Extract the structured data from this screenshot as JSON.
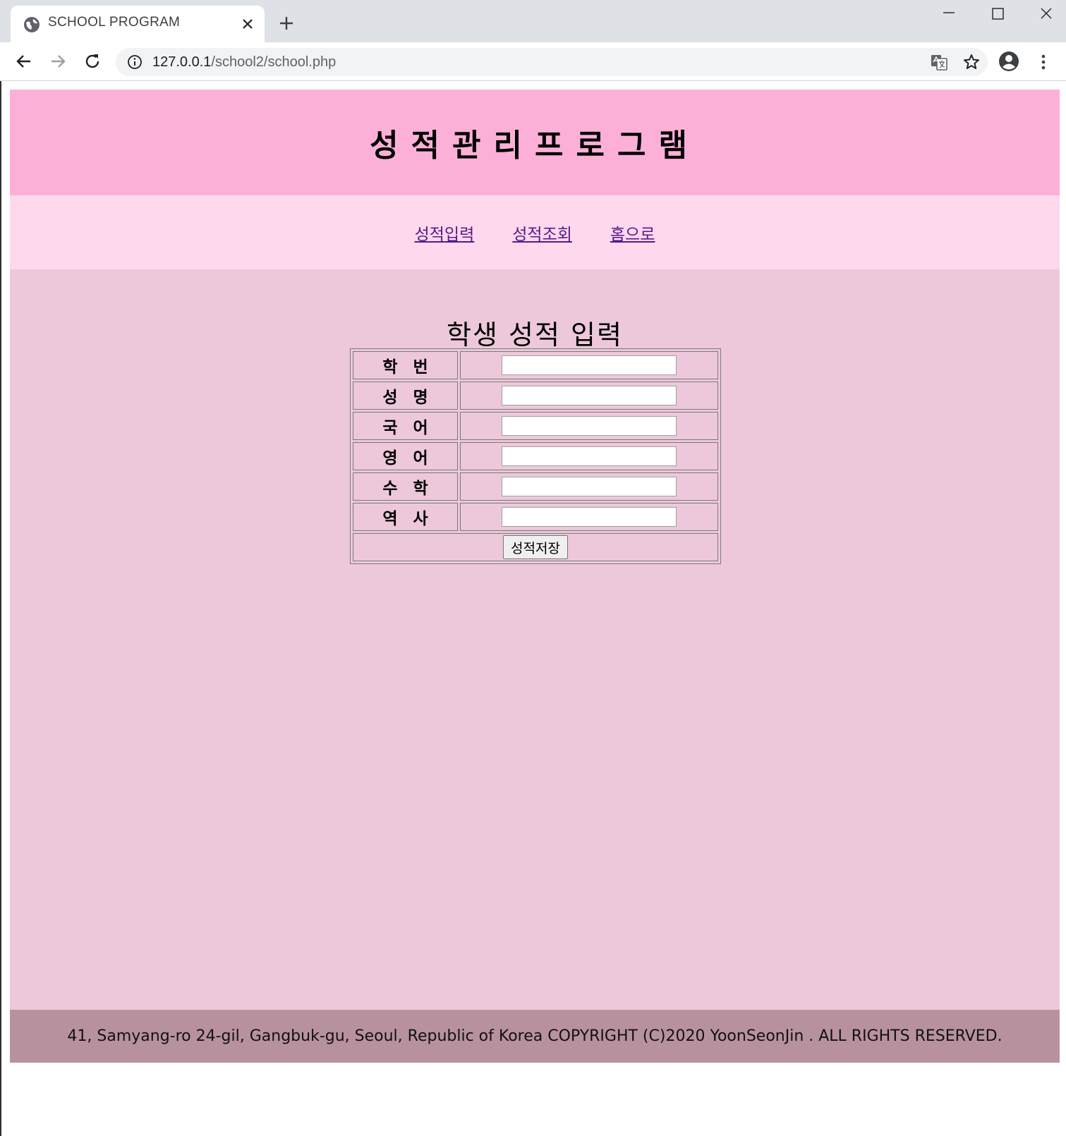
{
  "browser": {
    "tab_title": "SCHOOL PROGRAM",
    "url_host": "127.0.0.1",
    "url_path": "/school2/school.php"
  },
  "header": {
    "title": "성적관리프로그램"
  },
  "nav": {
    "items": [
      "성적입력",
      "성적조회",
      "홈으로"
    ]
  },
  "form": {
    "heading": "학생 성적 입력",
    "fields": [
      {
        "label": "학번",
        "value": ""
      },
      {
        "label": "성명",
        "value": ""
      },
      {
        "label": "국어",
        "value": ""
      },
      {
        "label": "영어",
        "value": ""
      },
      {
        "label": "수학",
        "value": ""
      },
      {
        "label": "역사",
        "value": ""
      }
    ],
    "submit_label": "성적저장"
  },
  "footer": {
    "text": "41, Samyang-ro 24-gil, Gangbuk-gu, Seoul, Republic of Korea COPYRIGHT (C)2020 YoonSeonJin . ALL RIGHTS RESERVED."
  },
  "colors": {
    "header_bg": "#fcb0d8",
    "nav_bg": "#fed8ec",
    "main_bg": "#ecc8da",
    "footer_bg": "#b8919f",
    "link": "#551a8b"
  }
}
